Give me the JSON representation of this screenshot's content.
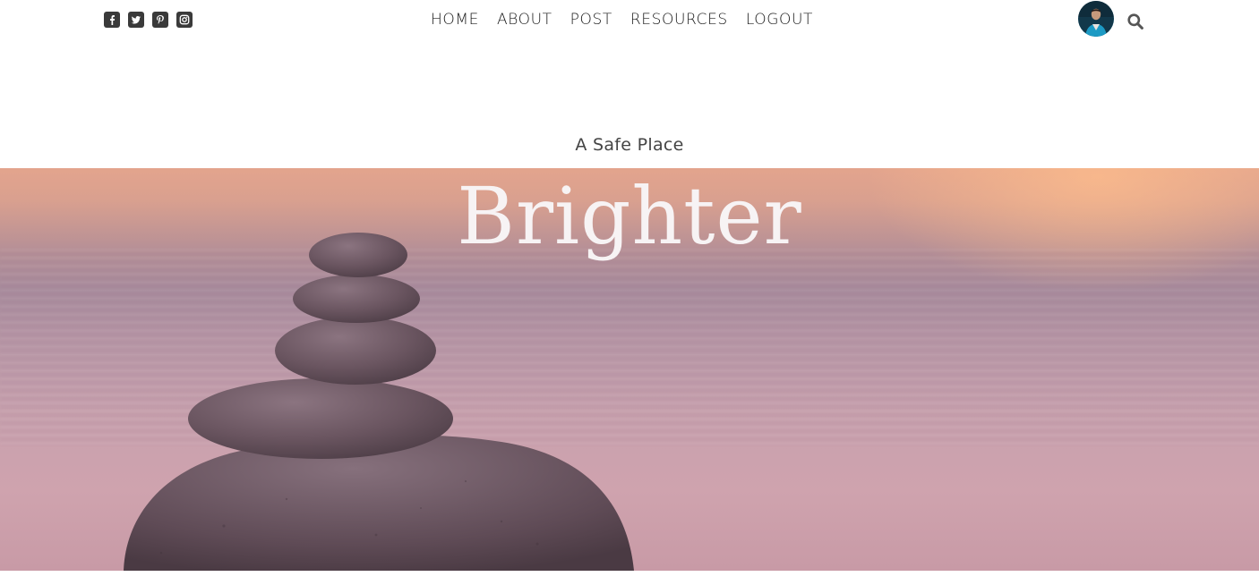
{
  "header": {
    "social": [
      {
        "name": "facebook-icon",
        "glyph": "f"
      },
      {
        "name": "twitter-icon",
        "glyph": "t"
      },
      {
        "name": "pinterest-icon",
        "glyph": "p"
      },
      {
        "name": "instagram-icon",
        "glyph": "i"
      }
    ],
    "nav": {
      "home": "HOME",
      "about": "ABOUT",
      "post": "POST",
      "resources": "RESOURCES",
      "logout": "LOGOUT"
    },
    "avatar_icon": "user-avatar",
    "search_icon": "search-icon"
  },
  "site": {
    "tagline": "A Safe Place",
    "title": "Brighter"
  },
  "colors": {
    "text": "#1a1a1a",
    "tagline": "#444444",
    "title": "#f7f3f4",
    "hero_top": "#e3a48d",
    "hero_mid": "#a88b9c",
    "stone": "#6e5a63"
  }
}
